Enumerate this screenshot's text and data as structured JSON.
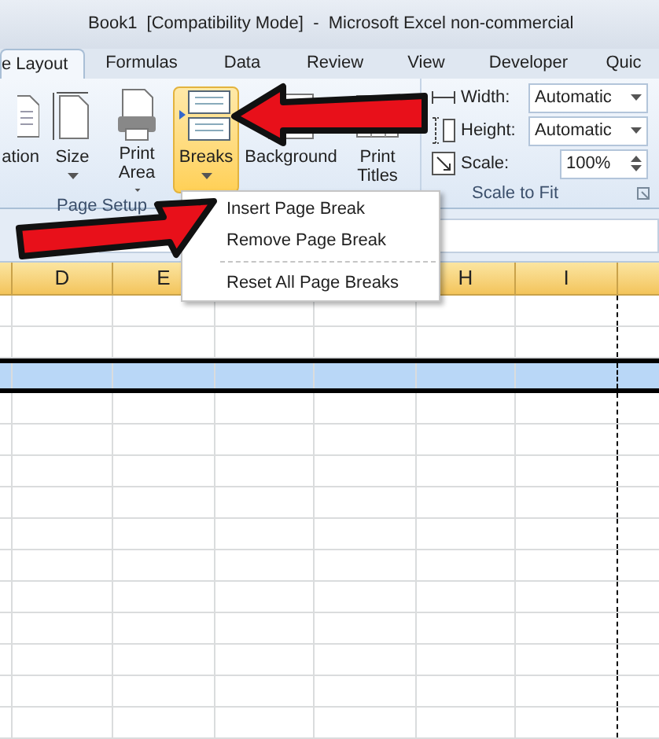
{
  "window": {
    "title": "Book1  [Compatibility Mode]  -  Microsoft Excel non-commercial"
  },
  "tabs": [
    {
      "label": "e Layout",
      "selected": true
    },
    {
      "label": "Formulas",
      "selected": false
    },
    {
      "label": "Data",
      "selected": false
    },
    {
      "label": "Review",
      "selected": false
    },
    {
      "label": "View",
      "selected": false
    },
    {
      "label": "Developer",
      "selected": false
    },
    {
      "label": "Quic",
      "selected": false
    }
  ],
  "page_setup": {
    "label": "Page Setup",
    "buttons": [
      {
        "kind": "orientation",
        "label": "ation",
        "selected": false
      },
      {
        "kind": "size",
        "label": "Size",
        "selected": false,
        "dropdown": true
      },
      {
        "kind": "print_area",
        "label": "Print Area",
        "selected": false,
        "dropdown": true
      },
      {
        "kind": "breaks",
        "label": "Breaks",
        "selected": true,
        "dropdown": true
      },
      {
        "kind": "background",
        "label": "Background",
        "selected": false
      },
      {
        "kind": "print_titles",
        "label": "Print Titles",
        "selected": false
      }
    ]
  },
  "scale_to_fit": {
    "label": "Scale to Fit",
    "rows": [
      {
        "kind": "width",
        "label": "Width:",
        "value": "Automatic"
      },
      {
        "kind": "height",
        "label": "Height:",
        "value": "Automatic"
      },
      {
        "kind": "scale",
        "label": "Scale:",
        "value": "100%"
      }
    ]
  },
  "breaks_menu": {
    "items": [
      {
        "label": "Insert Page Break"
      },
      {
        "label": "Remove Page Break"
      },
      {
        "label": "Reset All Page Breaks",
        "separator_before": true
      }
    ]
  },
  "sheet": {
    "columns_left": [
      "D",
      "E"
    ],
    "columns_right": [
      "H",
      "I"
    ]
  }
}
